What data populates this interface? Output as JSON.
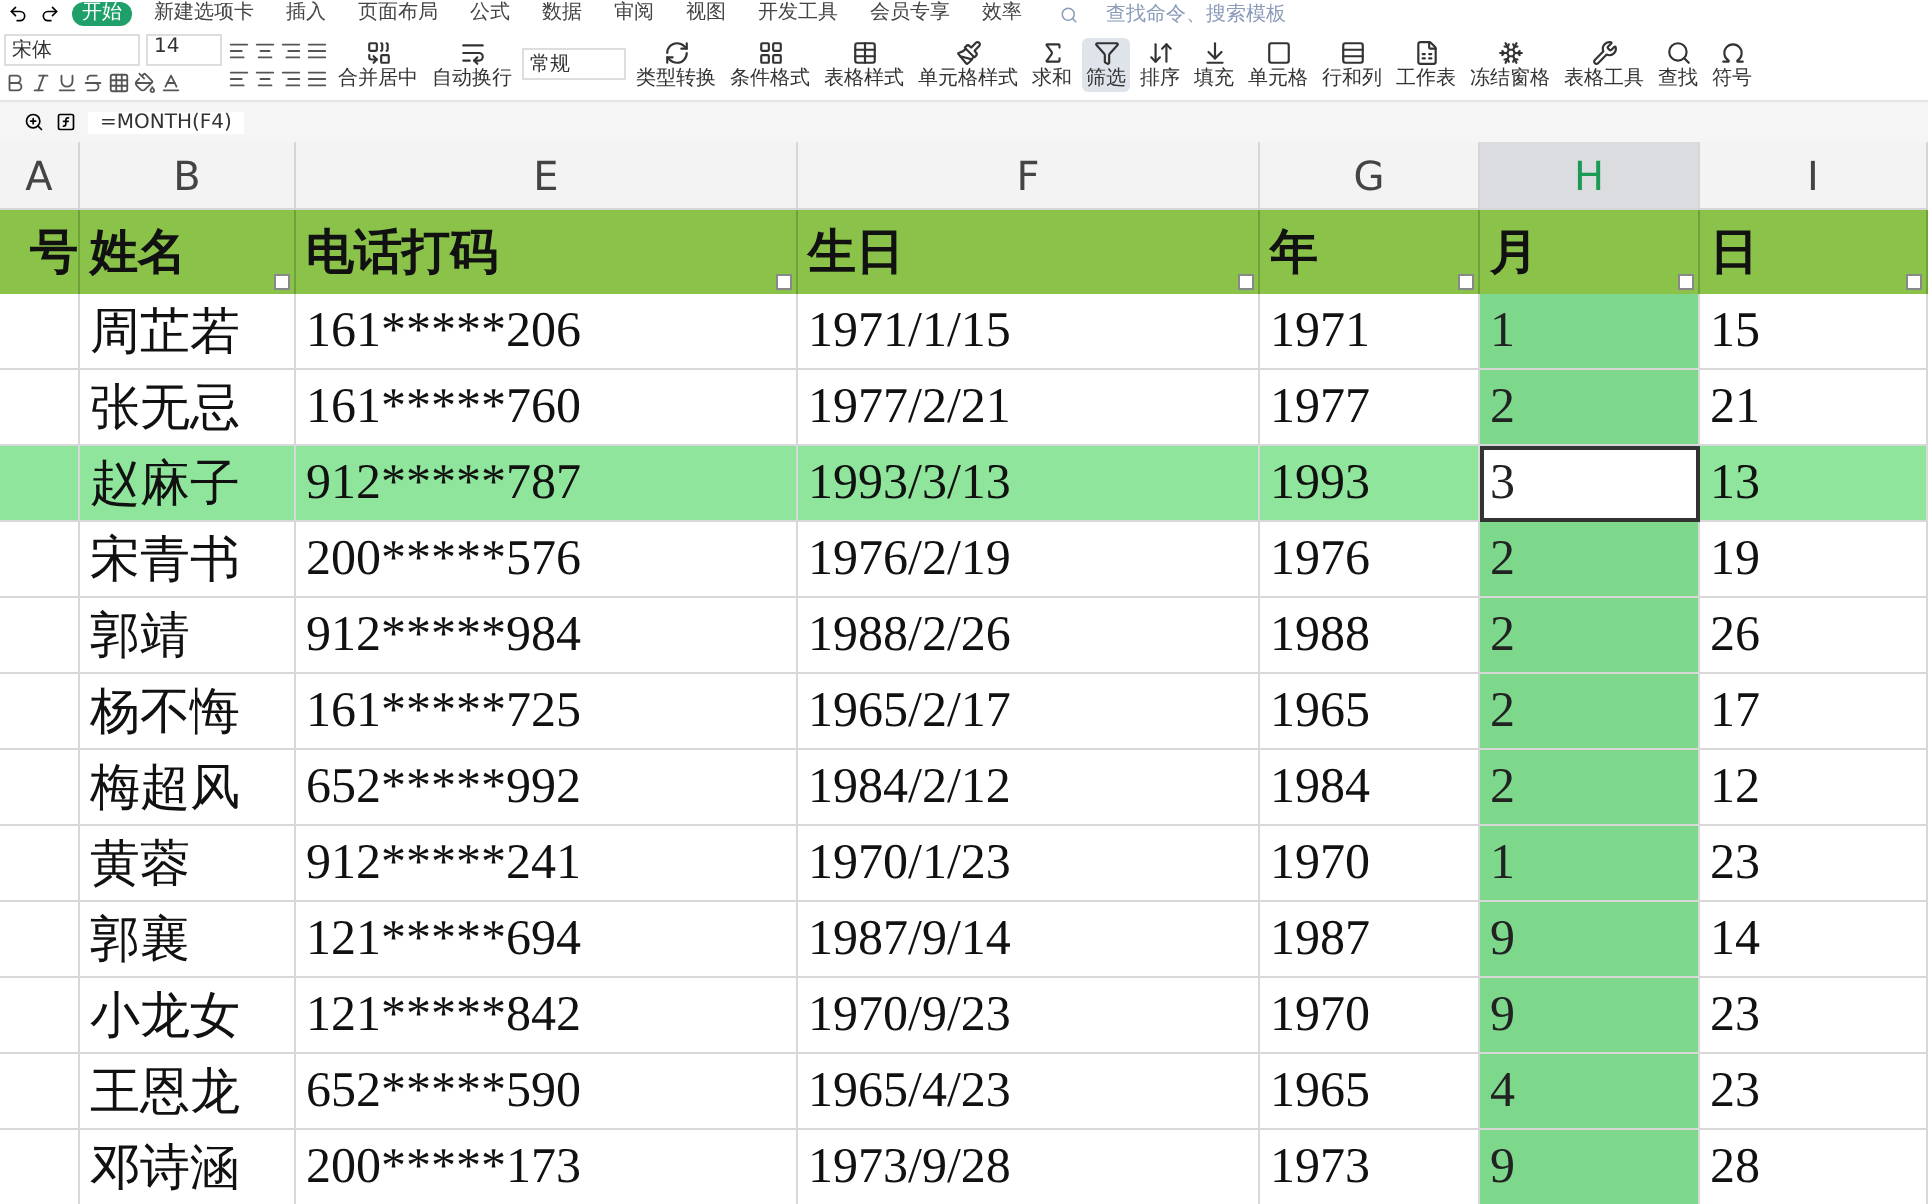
{
  "menu_tabs": [
    {
      "label": "开始",
      "selected": true
    },
    {
      "label": "新建选项卡",
      "selected": false
    },
    {
      "label": "插入",
      "selected": false
    },
    {
      "label": "页面布局",
      "selected": false
    },
    {
      "label": "公式",
      "selected": false
    },
    {
      "label": "数据",
      "selected": false
    },
    {
      "label": "审阅",
      "selected": false
    },
    {
      "label": "视图",
      "selected": false
    },
    {
      "label": "开发工具",
      "selected": false
    },
    {
      "label": "会员专享",
      "selected": false
    },
    {
      "label": "效率",
      "selected": false
    }
  ],
  "command_search": {
    "placeholder": "查找命令、搜索模板"
  },
  "font": {
    "name": "宋体",
    "size": "14"
  },
  "number_format": "常规",
  "ribbon_buttons": [
    {
      "label": "合并居中",
      "selected": false
    },
    {
      "label": "自动换行",
      "selected": false
    },
    {
      "label": "类型转换",
      "selected": false
    },
    {
      "label": "条件格式",
      "selected": false
    },
    {
      "label": "表格样式",
      "selected": false
    },
    {
      "label": "单元格样式",
      "selected": false
    },
    {
      "label": "求和",
      "selected": false
    },
    {
      "label": "筛选",
      "selected": true
    },
    {
      "label": "排序",
      "selected": false
    },
    {
      "label": "填充",
      "selected": false
    },
    {
      "label": "单元格",
      "selected": false
    },
    {
      "label": "行和列",
      "selected": false
    },
    {
      "label": "工作表",
      "selected": false
    },
    {
      "label": "冻结窗格",
      "selected": false
    },
    {
      "label": "表格工具",
      "selected": false
    },
    {
      "label": "查找",
      "selected": false
    },
    {
      "label": "符号",
      "selected": false
    }
  ],
  "formula_bar": {
    "formula": "=MONTH(F4)"
  },
  "columns": [
    {
      "letter": "A",
      "header": "号",
      "selected": false
    },
    {
      "letter": "B",
      "header": "姓名",
      "selected": false
    },
    {
      "letter": "E",
      "header": "电话打码",
      "selected": false
    },
    {
      "letter": "F",
      "header": "生日",
      "selected": false
    },
    {
      "letter": "G",
      "header": "年",
      "selected": false
    },
    {
      "letter": "H",
      "header": "月",
      "selected": true
    },
    {
      "letter": "I",
      "header": "日",
      "selected": false
    }
  ],
  "rows": [
    {
      "selected": false,
      "cells": [
        "周芷若",
        "161*****206",
        "1971/1/15",
        "1971",
        "1",
        "15"
      ]
    },
    {
      "selected": false,
      "cells": [
        "张无忌",
        "161*****760",
        "1977/2/21",
        "1977",
        "2",
        "21"
      ]
    },
    {
      "selected": true,
      "cells": [
        "赵麻子",
        "912*****787",
        "1993/3/13",
        "1993",
        "3",
        "13"
      ]
    },
    {
      "selected": false,
      "cells": [
        "宋青书",
        "200*****576",
        "1976/2/19",
        "1976",
        "2",
        "19"
      ]
    },
    {
      "selected": false,
      "cells": [
        "郭靖",
        "912*****984",
        "1988/2/26",
        "1988",
        "2",
        "26"
      ]
    },
    {
      "selected": false,
      "cells": [
        "杨不悔",
        "161*****725",
        "1965/2/17",
        "1965",
        "2",
        "17"
      ]
    },
    {
      "selected": false,
      "cells": [
        "梅超风",
        "652*****992",
        "1984/2/12",
        "1984",
        "2",
        "12"
      ]
    },
    {
      "selected": false,
      "cells": [
        "黄蓉",
        "912*****241",
        "1970/1/23",
        "1970",
        "1",
        "23"
      ]
    },
    {
      "selected": false,
      "cells": [
        "郭襄",
        "121*****694",
        "1987/9/14",
        "1987",
        "9",
        "14"
      ]
    },
    {
      "selected": false,
      "cells": [
        "小龙女",
        "121*****842",
        "1970/9/23",
        "1970",
        "9",
        "23"
      ]
    },
    {
      "selected": false,
      "cells": [
        "王恩龙",
        "652*****590",
        "1965/4/23",
        "1965",
        "4",
        "23"
      ]
    },
    {
      "selected": false,
      "cells": [
        "邓诗涵",
        "200*****173",
        "1973/9/28",
        "1973",
        "9",
        "28"
      ]
    }
  ]
}
